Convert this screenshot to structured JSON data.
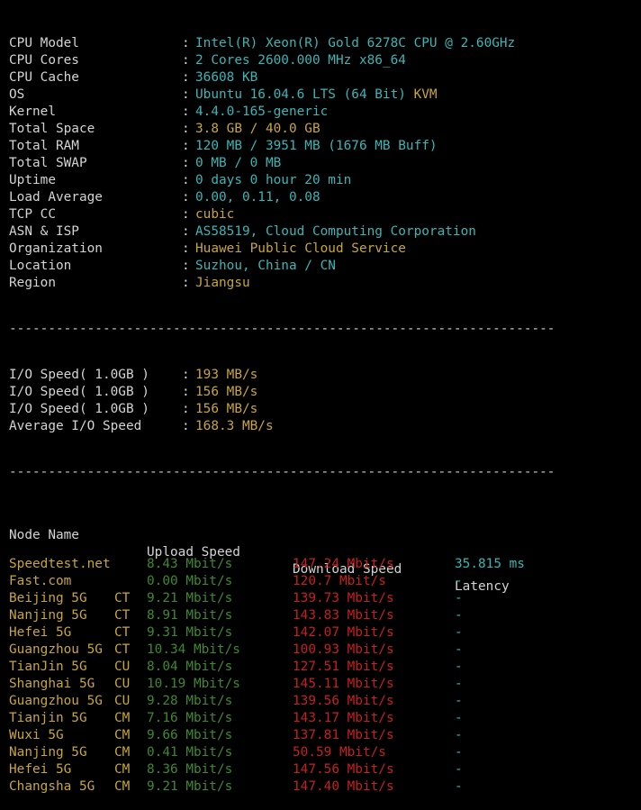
{
  "sysinfo": [
    {
      "label": "CPU Model",
      "value": "Intel(R) Xeon(R) Gold 6278C CPU @ 2.60GHz",
      "color": "cyan"
    },
    {
      "label": "CPU Cores",
      "value": "2 Cores 2600.000 MHz x86_64",
      "color": "cyan"
    },
    {
      "label": "CPU Cache",
      "value": "36608 KB",
      "color": "cyan"
    },
    {
      "label": "OS",
      "value": "Ubuntu 16.04.6 LTS (64 Bit)",
      "value2": "KVM",
      "color": "cyan"
    },
    {
      "label": "Kernel",
      "value": "4.4.0-165-generic",
      "color": "cyan"
    },
    {
      "label": "Total Space",
      "value": "3.8 GB / 40.0 GB",
      "color": "yellow"
    },
    {
      "label": "Total RAM",
      "value": "120 MB / 3951 MB (1676 MB Buff)",
      "color": "cyan"
    },
    {
      "label": "Total SWAP",
      "value": "0 MB / 0 MB",
      "color": "cyan"
    },
    {
      "label": "Uptime",
      "value": "0 days 0 hour 20 min",
      "color": "cyan"
    },
    {
      "label": "Load Average",
      "value": "0.00, 0.11, 0.08",
      "color": "cyan"
    },
    {
      "label": "TCP CC",
      "value": "cubic",
      "color": "yellow"
    },
    {
      "label": "ASN & ISP",
      "value": "AS58519, Cloud Computing Corporation",
      "color": "cyan"
    },
    {
      "label": "Organization",
      "value": "Huawei Public Cloud Service",
      "color": "yellow"
    },
    {
      "label": "Location",
      "value": "Suzhou, China / CN",
      "color": "cyan"
    },
    {
      "label": "Region",
      "value": "Jiangsu",
      "color": "yellow"
    }
  ],
  "separator": ":",
  "divider": "----------------------------------------------------------------------",
  "io": [
    {
      "label": "I/O Speed( 1.0GB )",
      "value": "193 MB/s"
    },
    {
      "label": "I/O Speed( 1.0GB )",
      "value": "156 MB/s"
    },
    {
      "label": "I/O Speed( 1.0GB )",
      "value": "156 MB/s"
    },
    {
      "label": "Average I/O Speed",
      "value": "168.3 MB/s"
    }
  ],
  "speed_header": {
    "node": "Node Name",
    "upload": "Upload Speed",
    "download": "Download Speed",
    "latency": "Latency"
  },
  "speed_rows": [
    {
      "node": "Speedtest.net",
      "isp": "",
      "upload": "8.43 Mbit/s",
      "download": "147.24 Mbit/s",
      "latency": "35.815 ms"
    },
    {
      "node": "Fast.com",
      "isp": "",
      "upload": "0.00 Mbit/s",
      "download": "120.7 Mbit/s",
      "latency": "-"
    },
    {
      "node": "Beijing 5G",
      "isp": "CT",
      "upload": "9.21 Mbit/s",
      "download": "139.73 Mbit/s",
      "latency": "-"
    },
    {
      "node": "Nanjing 5G",
      "isp": "CT",
      "upload": "8.91 Mbit/s",
      "download": "143.83 Mbit/s",
      "latency": "-"
    },
    {
      "node": "Hefei 5G",
      "isp": "CT",
      "upload": "9.31 Mbit/s",
      "download": "142.07 Mbit/s",
      "latency": "-"
    },
    {
      "node": "Guangzhou 5G",
      "isp": "CT",
      "upload": "10.34 Mbit/s",
      "download": "100.93 Mbit/s",
      "latency": "-"
    },
    {
      "node": "TianJin 5G",
      "isp": "CU",
      "upload": "8.04 Mbit/s",
      "download": "127.51 Mbit/s",
      "latency": "-"
    },
    {
      "node": "Shanghai 5G",
      "isp": "CU",
      "upload": "10.19 Mbit/s",
      "download": "145.11 Mbit/s",
      "latency": "-"
    },
    {
      "node": "Guangzhou 5G",
      "isp": "CU",
      "upload": "9.28 Mbit/s",
      "download": "139.56 Mbit/s",
      "latency": "-"
    },
    {
      "node": "Tianjin 5G",
      "isp": "CM",
      "upload": "7.16 Mbit/s",
      "download": "143.17 Mbit/s",
      "latency": "-"
    },
    {
      "node": "Wuxi 5G",
      "isp": "CM",
      "upload": "9.66 Mbit/s",
      "download": "137.81 Mbit/s",
      "latency": "-"
    },
    {
      "node": "Nanjing 5G",
      "isp": "CM",
      "upload": "0.41 Mbit/s",
      "download": "50.59 Mbit/s",
      "latency": "-"
    },
    {
      "node": "Hefei 5G",
      "isp": "CM",
      "upload": "8.36 Mbit/s",
      "download": "147.56 Mbit/s",
      "latency": "-"
    },
    {
      "node": "Changsha 5G",
      "isp": "CM",
      "upload": "9.21 Mbit/s",
      "download": "147.40 Mbit/s",
      "latency": "-"
    }
  ],
  "colors": {
    "background": "#000000",
    "label": "#d4d4d4",
    "cyan": "#3ab6b6",
    "yellow": "#c8a63a",
    "green": "#3d8a2e",
    "red": "#c62020"
  }
}
